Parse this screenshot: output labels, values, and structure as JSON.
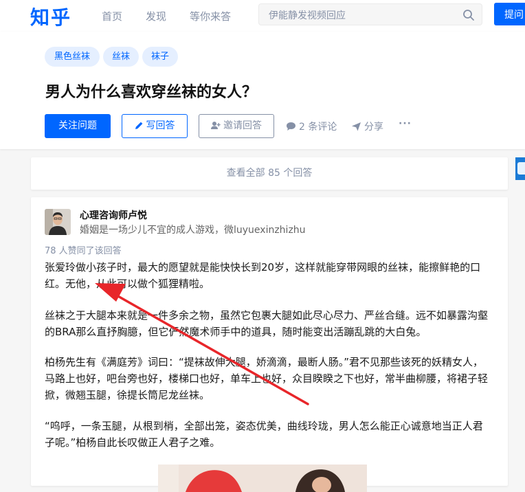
{
  "header": {
    "logo": "知乎",
    "nav": [
      "首页",
      "发现",
      "等你来答"
    ],
    "search_placeholder": "伊能静发视频回应",
    "ask_button": "提问"
  },
  "question": {
    "tags": [
      "黑色丝袜",
      "丝袜",
      "袜子"
    ],
    "title": "男人为什么喜欢穿丝袜的女人？",
    "follow_button": "关注问题",
    "write_button": "写回答",
    "invite_button": "邀请回答",
    "comments": "2 条评论",
    "share": "分享",
    "more": "···"
  },
  "view_all": "查看全部 85 个回答",
  "answer": {
    "author_name": "心理咨询师卢悦",
    "author_bio": "婚姻是一场少儿不宜的成人游戏，微luyuexinzhizhu",
    "votes": "78 人赞同了该回答",
    "paragraphs": [
      "张爱玲做小孩子时，最大的愿望就是能快快长到20岁，这样就能穿带网眼的丝袜，能擦鲜艳的口红。无他，从此可以做个狐狸精啦。",
      "丝袜之于大腿本来就是一件多余之物，虽然它包裹大腿如此尽心尽力、严丝合缝。远不如暴露沟壑的BRA那么直抒胸臆，但它俨然魔术师手中的道具，随时能变出活蹦乱跳的大白兔。",
      "柏杨先生有《满庭芳》词曰：“提袜故伸大腿，娇滴滴，最断人肠。”君不见那些该死的妖精女人，马路上也好，吧台旁也好，楼梯口也好，单车上也好，众目睽睽之下也好，常半曲柳腰，将裙子轻掀，微翘玉腿，徐提长筒尼龙丝袜。",
      "“呜呼，一条玉腿，从根到梢，全部出笼，姿态优美，曲线玲珑，男人怎么能正心诚意地当正人君子呢。”柏杨自此长叹做正人君子之难。"
    ]
  },
  "colors": {
    "brand": "#0066ff",
    "annotation_arrow": "#e8262a"
  }
}
